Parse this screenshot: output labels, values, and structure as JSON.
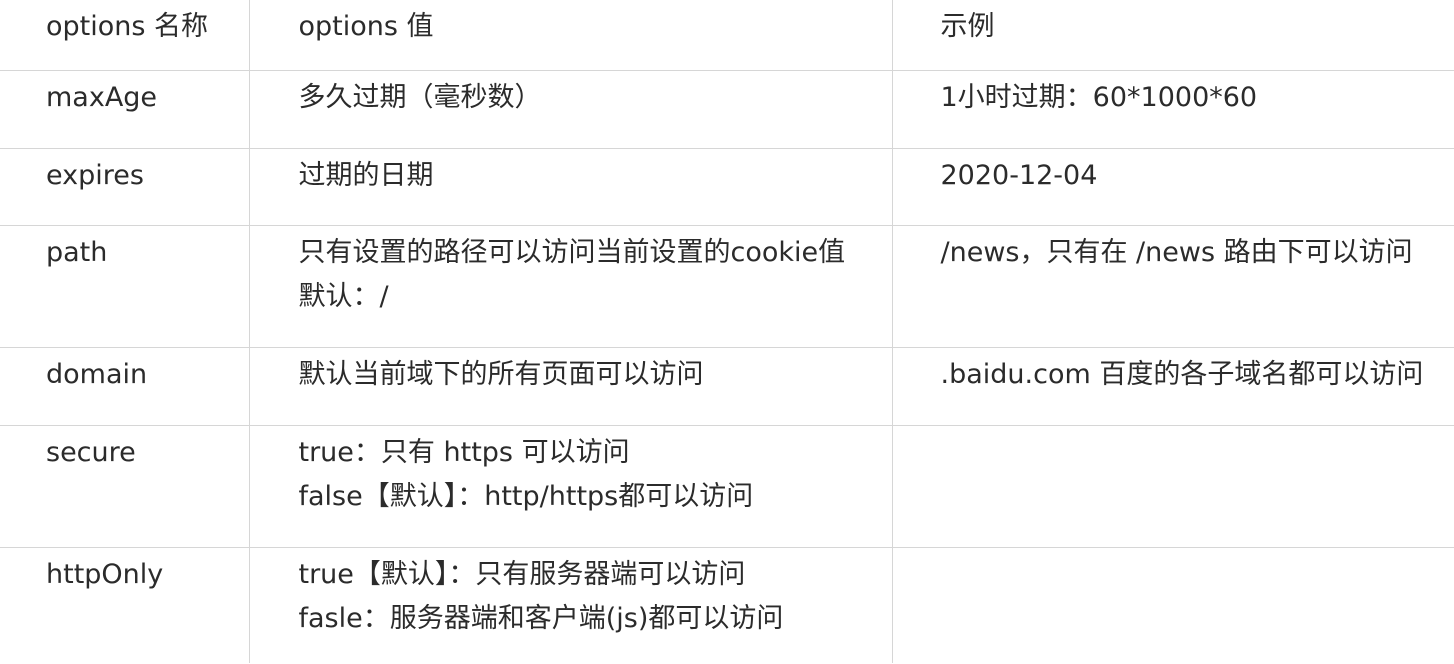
{
  "table": {
    "headers": {
      "name": "options 名称",
      "value": "options 值",
      "example": "示例"
    },
    "rows": [
      {
        "name": "maxAge",
        "value": [
          "多久过期（毫秒数）"
        ],
        "example": "1小时过期：60*1000*60"
      },
      {
        "name": "expires",
        "value": [
          "过期的日期"
        ],
        "example": "2020-12-04"
      },
      {
        "name": "path",
        "value": [
          "只有设置的路径可以访问当前设置的cookie值",
          "默认：/"
        ],
        "example": "/news，只有在 /news 路由下可以访问"
      },
      {
        "name": "domain",
        "value": [
          "默认当前域下的所有页面可以访问"
        ],
        "example": ".baidu.com 百度的各子域名都可以访问"
      },
      {
        "name": "secure",
        "value": [
          "true：只有 https 可以访问",
          "false【默认】：http/https都可以访问"
        ],
        "example": ""
      },
      {
        "name": "httpOnly",
        "value": [
          "true【默认】：只有服务器端可以访问",
          "fasle：服务器端和客户端(js)都可以访问"
        ],
        "example": ""
      }
    ]
  }
}
